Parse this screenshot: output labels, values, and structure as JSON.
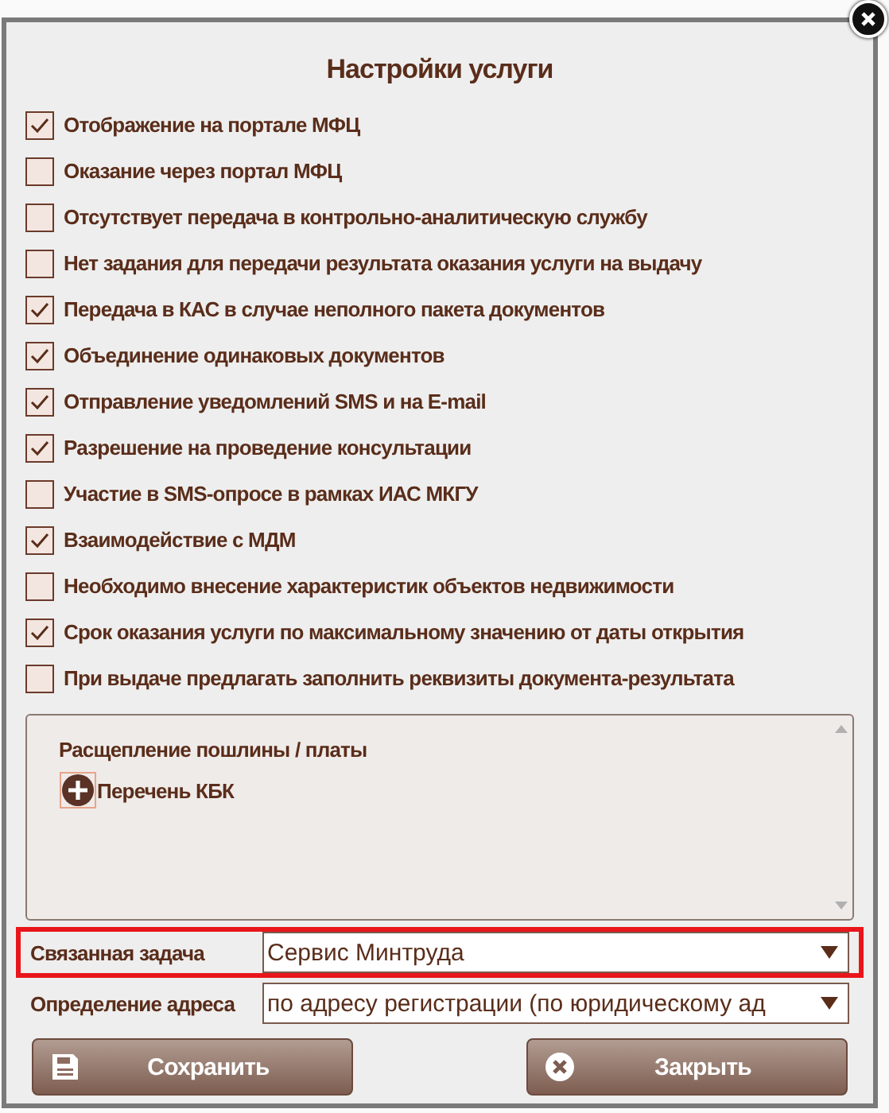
{
  "dialog": {
    "title": "Настройки услуги"
  },
  "options": [
    {
      "label": "Отображение на портале МФЦ",
      "checked": true
    },
    {
      "label": "Оказание через портал МФЦ",
      "checked": false
    },
    {
      "label": "Отсутствует передача в контрольно-аналитическую службу",
      "checked": false
    },
    {
      "label": "Нет задания для передачи результата оказания услуги на выдачу",
      "checked": false
    },
    {
      "label": "Передача в КАС в случае неполного пакета документов",
      "checked": true
    },
    {
      "label": "Объединение одинаковых документов",
      "checked": true
    },
    {
      "label": "Отправление уведомлений SMS и на E-mail",
      "checked": true
    },
    {
      "label": "Разрешение на проведение консультации",
      "checked": true
    },
    {
      "label": "Участие в SMS-опросе в рамках ИАС МКГУ",
      "checked": false
    },
    {
      "label": "Взаимодействие с МДМ",
      "checked": true
    },
    {
      "label": "Необходимо внесение характеристик объектов недвижимости",
      "checked": false
    },
    {
      "label": "Срок оказания услуги по максимальному значению от даты открытия",
      "checked": true
    },
    {
      "label": "При выдаче предлагать заполнить реквизиты документа-результата",
      "checked": false
    }
  ],
  "split_panel": {
    "heading": "Расщепление пошлины / платы",
    "add_label": "Перечень КБК"
  },
  "fields": [
    {
      "label": "Связанная задача",
      "value": "Сервис Минтруда",
      "highlighted": true
    },
    {
      "label": "Определение адреса",
      "value": "по адресу регистрации (по юридическому ад",
      "highlighted": false
    }
  ],
  "buttons": [
    {
      "label": "Сохранить",
      "kind": "save"
    },
    {
      "label": "Закрыть",
      "kind": "close"
    }
  ]
}
